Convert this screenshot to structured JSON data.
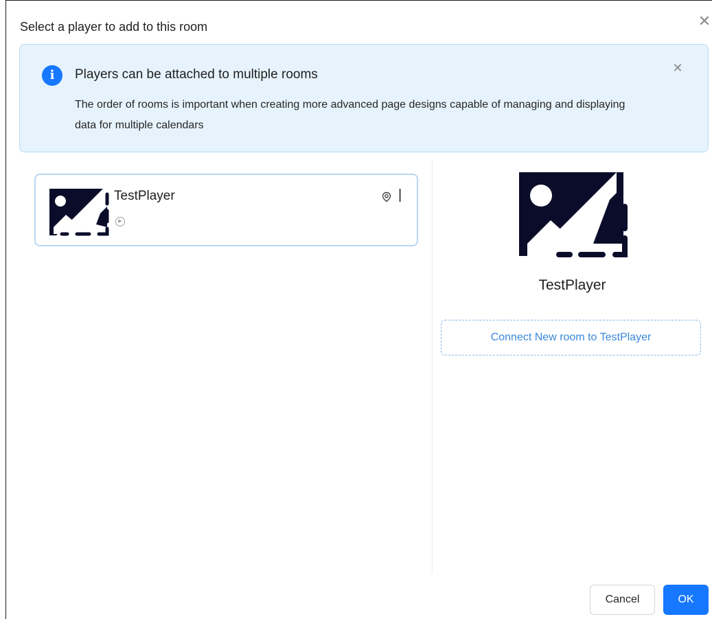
{
  "dialog": {
    "title": "Select a player to add to this room",
    "close_icon": "close-icon"
  },
  "alert": {
    "icon": "info-icon",
    "title": "Players can be attached to multiple rooms",
    "body": "The order of rooms is important when creating more advanced page designs capable of managing and displaying data for multiple calendars",
    "close_icon": "close-icon"
  },
  "players": [
    {
      "name": "TestPlayer",
      "thumb_icon": "broken-image-icon",
      "status_icon": "play-circle-icon",
      "location_icon": "map-pin-icon"
    }
  ],
  "preview": {
    "name": "TestPlayer",
    "image_icon": "broken-image-icon",
    "connect_label": "Connect New room to TestPlayer"
  },
  "footer": {
    "cancel_label": "Cancel",
    "ok_label": "OK"
  },
  "colors": {
    "primary": "#1677ff",
    "alert_bg": "#e6f3fc",
    "alert_border": "#b9dbf3",
    "selected_border": "#bcd6f4",
    "link": "#3a88d8"
  }
}
